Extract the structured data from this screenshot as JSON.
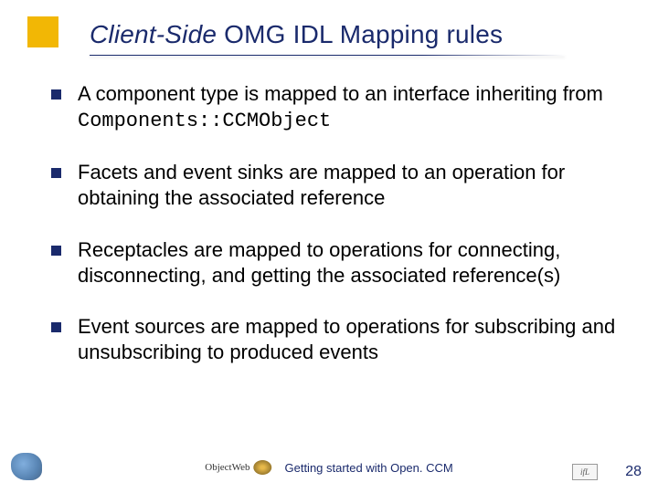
{
  "title": {
    "italic_part": "Client-Side",
    "rest": " OMG IDL Mapping rules"
  },
  "bullets": [
    {
      "pre": "A component type is mapped to an interface inheriting from ",
      "code": "Components::CCMObject",
      "post": ""
    },
    {
      "pre": "Facets and event sinks are mapped to an operation for obtaining the associated reference",
      "code": "",
      "post": ""
    },
    {
      "pre": "Receptacles are mapped to operations for connecting, disconnecting, and getting the associated reference(s)",
      "code": "",
      "post": ""
    },
    {
      "pre": "Event sources are mapped to operations for subscribing and unsubscribing to produced events",
      "code": "",
      "post": ""
    }
  ],
  "footer": {
    "objectweb_label": "ObjectWeb",
    "center_text": "Getting started with Open. CCM",
    "right_box": "ifL",
    "page_number": "28"
  }
}
